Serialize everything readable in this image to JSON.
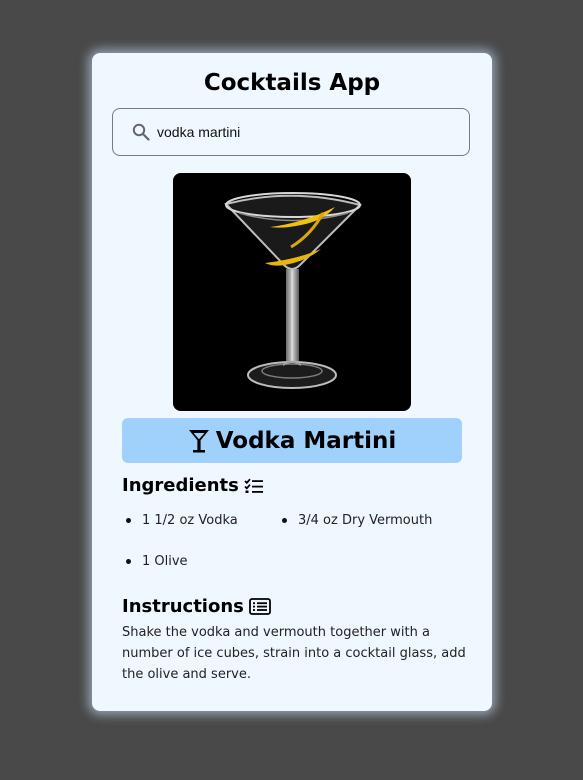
{
  "app": {
    "title": "Cocktails App"
  },
  "search": {
    "value": "vodka martini",
    "icon": "search-icon"
  },
  "drink": {
    "image_alt": "vodka martini cocktail glass with lemon twist",
    "name": "Vodka Martini",
    "name_icon": "cocktail-glass-icon"
  },
  "ingredients": {
    "heading": "Ingredients",
    "icon": "checklist-icon",
    "items": [
      {
        "label": "1 1/2 oz Vodka"
      },
      {
        "label": "3/4 oz Dry Vermouth"
      },
      {
        "label": "1 Olive"
      }
    ]
  },
  "instructions": {
    "heading": "Instructions",
    "icon": "list-card-icon",
    "text": "Shake the vodka and vermouth together with a number of ice cubes, strain into a cocktail glass, add the olive and serve."
  },
  "colors": {
    "background": "#494949",
    "card": "#eff7ff",
    "banner": "#9fd1fc",
    "text": "#000000"
  }
}
